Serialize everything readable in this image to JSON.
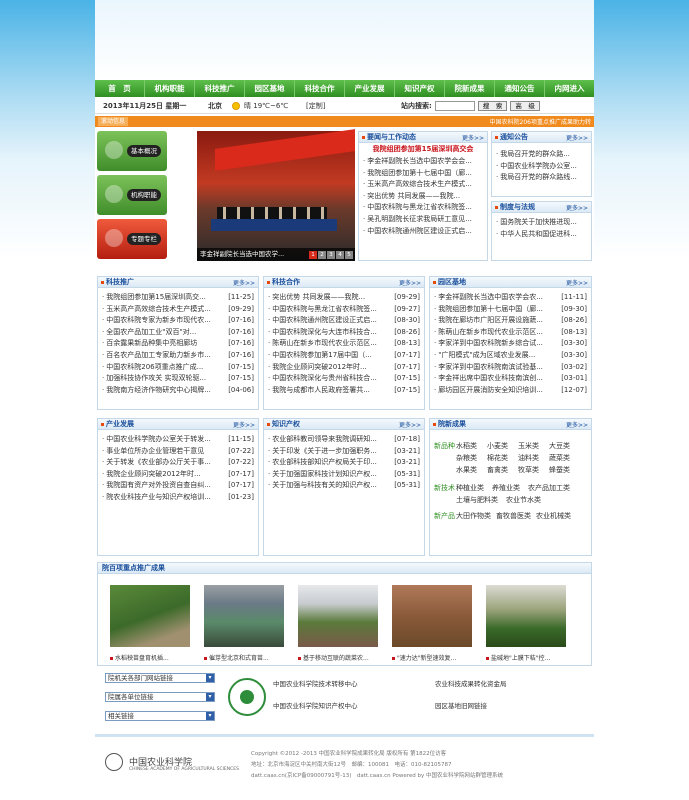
{
  "nav": [
    "首　页",
    "机构职能",
    "科技推广",
    "园区基地",
    "科技合作",
    "产业发展",
    "知识产权",
    "院新成果",
    "通知公告",
    "内网进入"
  ],
  "datebar": {
    "date": "2013年11月25日 星期一",
    "city": "北京",
    "weather": "晴",
    "temp": "19℃~6℃",
    "custom": "[定制]",
    "search_label": "站内搜索:",
    "search_btn": "搜　索",
    "advanced_btn": "高　级"
  },
  "notice": {
    "label": "滚动信息",
    "text": "中国农科院206项重点推广成果助力转"
  },
  "left_buttons": [
    "基本概况",
    "机构职能",
    "专题专栏"
  ],
  "slideshow": {
    "caption": "李金祥副院长当选中国农学...",
    "pages": [
      "1",
      "2",
      "3",
      "4",
      "5"
    ]
  },
  "news": {
    "title": "要闻与工作动态",
    "more": "更多>>",
    "headline": "我院组团参加第15届深圳高交会",
    "items": [
      "李金祥副院长当选中国农学会会...",
      "我院组团参加第十七届中国（廊...",
      "玉米高产高效综合技术生产模式...",
      "突出优势 共同发展——我院...",
      "中国农科院与黑龙江省农科院签...",
      "吴孔明副院长征求我局研工意见...",
      "中国农科院通州院区建设正式启..."
    ]
  },
  "notice_box": {
    "title": "通知公告",
    "more": "更多>>",
    "items": [
      "我局召开党的群众路...",
      "中国农业科学院办公室...",
      "我局召开党的群众路线..."
    ]
  },
  "regulations": {
    "title": "制度与法规",
    "more": "更多>>",
    "items": [
      "国务院关于加快推进现...",
      "中华人民共和国促进科..."
    ]
  },
  "tech_promo": {
    "title": "科技推广",
    "more": "更多>>",
    "items": [
      {
        "t": "我院组团参加第15届深圳高交...",
        "d": "[11-25]"
      },
      {
        "t": "玉米高产高效综合技术生产模式...",
        "d": "[09-29]"
      },
      {
        "t": "中国农科院专家为新乡市现代农...",
        "d": "[07-16]"
      },
      {
        "t": "全国农产品加工业\"双百\"对...",
        "d": "[07-16]"
      },
      {
        "t": "百余露果新品种集中亮相廊坊",
        "d": "[07-16]"
      },
      {
        "t": "百名农产品加工专家助力新乡市...",
        "d": "[07-16]"
      },
      {
        "t": "中国农科院206项重点推广成...",
        "d": "[07-15]"
      },
      {
        "t": "加强科技协作攻关 实现双轮驱...",
        "d": "[07-15]"
      },
      {
        "t": "我院南方经济作物研究中心揭牌...",
        "d": "[04-06]"
      }
    ]
  },
  "tech_coop": {
    "title": "科技合作",
    "more": "更多>>",
    "items": [
      {
        "t": "突出优势 共同发展——我院...",
        "d": "[09-29]"
      },
      {
        "t": "中国农科院与黑龙江省农科院签...",
        "d": "[09-27]"
      },
      {
        "t": "中国农科院通州院区建设正式启...",
        "d": "[08-30]"
      },
      {
        "t": "中国农科院深化与大连市科技合...",
        "d": "[08-26]"
      },
      {
        "t": "陈萌山在新乡市现代农业示范区...",
        "d": "[08-13]"
      },
      {
        "t": "中国农科院参加第17届中国（...",
        "d": "[07-17]"
      },
      {
        "t": "我院企业顾问突破2012年时...",
        "d": "[07-17]"
      },
      {
        "t": "中国农科院深化与贵州省科技合...",
        "d": "[07-15]"
      },
      {
        "t": "我院与成都市人民政府签署共...",
        "d": "[07-15]"
      }
    ]
  },
  "park_base": {
    "title": "园区基地",
    "more": "更多>>",
    "items": [
      {
        "t": "李金祥副院长当选中国农学会农...",
        "d": "[11-11]"
      },
      {
        "t": "我院组团参加第十七届中国（廊...",
        "d": "[09-30]"
      },
      {
        "t": "我院在廊坊市广阳区开展设施蔬...",
        "d": "[08-26]"
      },
      {
        "t": "陈萌山在新乡市现代农业示范区...",
        "d": "[08-13]"
      },
      {
        "t": "李家洋到中国农科院新乡综合试...",
        "d": "[03-30]"
      },
      {
        "t": "\"广阳模式\"成为区域农业发展...",
        "d": "[03-30]"
      },
      {
        "t": "李家洋到中国农科院南滨试验基...",
        "d": "[03-02]"
      },
      {
        "t": "李金祥出席中国农业科技南滨创...",
        "d": "[03-01]"
      },
      {
        "t": "廊坊园区开展消防安全知识培训...",
        "d": "[12-07]"
      }
    ]
  },
  "industry": {
    "title": "产业发展",
    "more": "更多>>",
    "items": [
      {
        "t": "中国农业科学院办公室关于转发...",
        "d": "[11-15]"
      },
      {
        "t": "事业单位所办企业管理若干意见",
        "d": "[07-22]"
      },
      {
        "t": "关于转发《农业部办公厅关于事...",
        "d": "[07-22]"
      },
      {
        "t": "我院企业顾问突破2012年时...",
        "d": "[07-17]"
      },
      {
        "t": "我院国有资产对外投资自查自纠...",
        "d": "[07-17]"
      },
      {
        "t": "院农业科技产业与知识产权培训...",
        "d": "[01-23]"
      }
    ]
  },
  "ip": {
    "title": "知识产权",
    "more": "更多>>",
    "items": [
      {
        "t": "农业部科教司领导来我院调研知...",
        "d": "[07-18]"
      },
      {
        "t": "关于印发《关于进一步加强职务...",
        "d": "[03-21]"
      },
      {
        "t": "农业部科技部知识产权局关于印...",
        "d": "[03-21]"
      },
      {
        "t": "关于加强国家科技计划知识产权...",
        "d": "[05-31]"
      },
      {
        "t": "关于加强与科技有关的知识产权...",
        "d": "[05-31]"
      }
    ]
  },
  "results": {
    "title": "院新成果",
    "more": "更多>>",
    "rows": [
      {
        "label": "新品种",
        "vals": [
          "水稻类",
          "小麦类",
          "玉米类",
          "大豆类"
        ]
      },
      {
        "label": "",
        "vals": [
          "杂粮类",
          "棉花类",
          "油料类",
          "蔬菜类"
        ]
      },
      {
        "label": "",
        "vals": [
          "水果类",
          "畜禽类",
          "牧草类",
          "蜂蚕类"
        ]
      },
      {
        "label": "新技术",
        "vals": [
          "种植业类",
          "养殖业类",
          "农产品加工类"
        ]
      },
      {
        "label": "",
        "vals": [
          "土壤与肥料类",
          "农业节水类"
        ]
      },
      {
        "label": "新产品",
        "vals": [
          "大田作物类",
          "畜牧兽医类",
          "农业机械类"
        ]
      }
    ]
  },
  "strip": {
    "title": "院百项重点推广成果",
    "captions": [
      "水稻秧苗盘育机插...",
      "催芽型北京和式育苗...",
      "基于移动互联的蔬菜农...",
      "\"速力达\"新型速效复...",
      "盐碱地\"上膜下秸\"控..."
    ]
  },
  "links": {
    "selects": [
      "院机关各部门网站链接",
      "院属各单位链接",
      "相关链接"
    ],
    "items": [
      "中国农业科学院技术转移中心",
      "农业科技成果转化资金局",
      "中国农业科学院知识产权中心",
      "园区基地旧网链接"
    ]
  },
  "footer": {
    "name": "中国农业科学院",
    "name_en": "CHINESE ACADEMY OF AGRICULTURAL SCIENCES",
    "lines": [
      "Copyright ©2012 -2013 中国农业科学院成果转化局 版权所有 第1822位访客",
      "地址：北京市海淀区中关村南大街12号　邮编：100081　电话：010-82105787",
      "datt.caas.cn(京ICP备09000791号-13)　datt.caas.cn Powered by 中国农业科学院网站群管理系统"
    ]
  },
  "colors": {
    "nav_green": "#3b9a2a",
    "title_blue": "#1a4f9c",
    "orange": "#f08a1c",
    "headline_red": "#c8161d"
  }
}
